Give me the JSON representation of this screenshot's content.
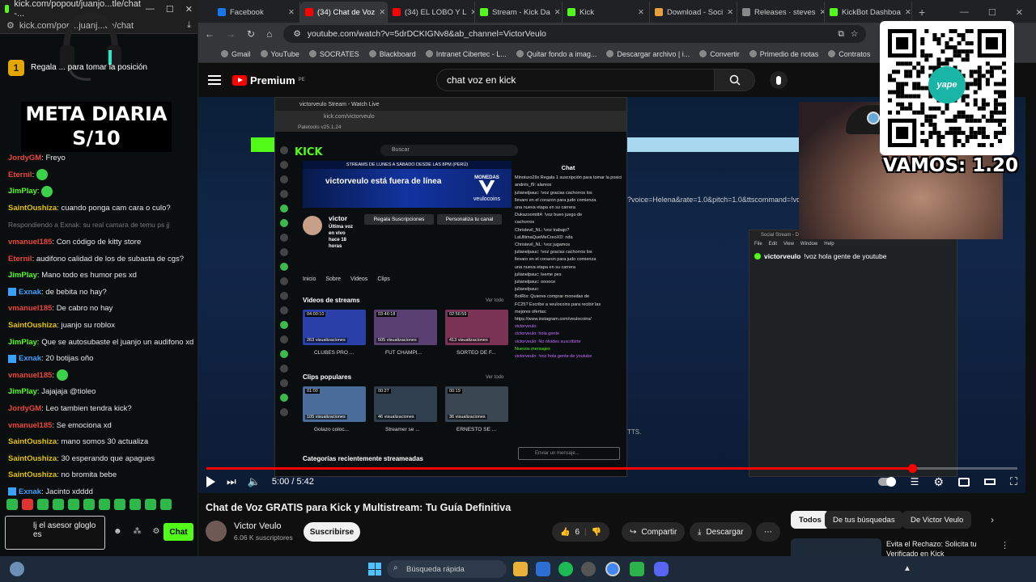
{
  "popout": {
    "title": "kick.com/popout/juanjo...tle/chat -...",
    "url": "kick.com/pop...juanj...tle/chat",
    "pinned_text": "Regala ... para tomar la posición",
    "pinned_badge": "1",
    "meta_line1": "META DIARIA",
    "meta_line2": "S/10",
    "messages": [
      {
        "user": "JordyGM",
        "text": "Freyo",
        "color": "#e9463b"
      },
      {
        "user": "Eternil",
        "text": "",
        "color": "#e9463b",
        "emote": true
      },
      {
        "user": "JimPlay",
        "text": "",
        "color": "#53fc18",
        "emote": true
      },
      {
        "user": "SaintOushiza",
        "text": "cuando ponga cam cara o culo?",
        "color": "#e3c300"
      },
      {
        "reply": "Respondiendo a Exnak: su real camara de temu ps jj"
      },
      {
        "user": "vmanuel185",
        "text": "Con código de kitty store",
        "color": "#e9463b"
      },
      {
        "user": "Eternil",
        "text": "audifono calidad de los de subasta de cgs?",
        "color": "#e9463b"
      },
      {
        "user": "JimPlay",
        "text": "Mano todo es humor pes xd",
        "color": "#53fc18"
      },
      {
        "user": "Exnak",
        "text": "de bebita no hay?",
        "color": "#3aa1ff",
        "badge": true
      },
      {
        "user": "vmanuel185",
        "text": "De cabro no hay",
        "color": "#e9463b"
      },
      {
        "user": "SaintOushiza",
        "text": "juanjo su roblox",
        "color": "#e3c300"
      },
      {
        "user": "JimPlay",
        "text": "Que se autosubaste el juanjo un audifono xd",
        "color": "#53fc18"
      },
      {
        "user": "Exnak",
        "text": "20 botijas oño",
        "color": "#3aa1ff",
        "badge": true
      },
      {
        "user": "vmanuel185",
        "text": "",
        "color": "#e9463b",
        "emote": true
      },
      {
        "user": "JimPlay",
        "text": "Jajajaja @tioleo",
        "color": "#53fc18"
      },
      {
        "user": "JordyGM",
        "text": "Leo tambien tendra kick?",
        "color": "#e9463b"
      },
      {
        "user": "vmanuel185",
        "text": "Se emociona xd",
        "color": "#e9463b"
      },
      {
        "user": "SaintOushiza",
        "text": "mano somos 30 actualiza",
        "color": "#e3c300"
      },
      {
        "user": "SaintOushiza",
        "text": "30 esperando que apagues",
        "color": "#e3c300"
      },
      {
        "user": "SaintOushiza",
        "text": "no bromita bebe",
        "color": "#e3c300"
      },
      {
        "user": "Exnak",
        "text": "Jacinto xdddd",
        "color": "#3aa1ff",
        "badge": true
      }
    ],
    "input_value": "lj el asesor gloglo es",
    "chat_button": "Chat"
  },
  "tabs": [
    {
      "label": "Facebook",
      "color": "#1877f2"
    },
    {
      "label": "(34) Chat de Voz",
      "color": "#ff0000",
      "active": true
    },
    {
      "label": "(34) EL LOBO Y L",
      "color": "#ff0000"
    },
    {
      "label": "Stream - Kick Da",
      "color": "#53fc18"
    },
    {
      "label": "Kick",
      "color": "#53fc18"
    },
    {
      "label": "Download - Soci",
      "color": "#e8a13a"
    },
    {
      "label": "Releases · steves",
      "color": "#888888"
    },
    {
      "label": "KickBot Dashboa",
      "color": "#53fc18"
    }
  ],
  "address": {
    "url": "youtube.com/watch?v=5drDCKIGNv8&ab_channel=VictorVeulo"
  },
  "bookmarks": [
    "Gmail",
    "YouTube",
    "SOCRATES",
    "Blackboard",
    "Intranet Cibertec - L...",
    "Quitar fondo a imag...",
    "Descargar archivo | i...",
    "Convertir",
    "Primedio de notas",
    "Contratos",
    "https://ciber"
  ],
  "youtube": {
    "brand": "Premium",
    "region": "PE",
    "search_value": "chat voz en kick"
  },
  "video": {
    "inner_title": "victorveulo Stream - Watch Live",
    "inner_url": "kick.com/victorveulo",
    "inner_bar": "Paletools v25.1.24",
    "kick_logo": "KICK",
    "kick_search": "Buscar",
    "banner_stripe": "STREAMS DE LUNES A SÁBADO DESDE LAS 8PM (PERÚ)",
    "banner_offline": "victorveulo está fuera de línea",
    "banner_logo": "veulocoins",
    "banner_tag": "MONEDAS",
    "profile_name": "victor",
    "profile_status": "Última voz en vivo hace 18 horas",
    "btn_subs": "Regala Suscripciones",
    "btn_custom": "Personaliza tu canal",
    "nav": [
      "Inicio",
      "Sobre",
      "Videos",
      "Clips"
    ],
    "sec_videos": "Videos de streams",
    "sec_clips": "Clips populares",
    "ver_todo": "Ver todo",
    "videos": [
      {
        "dur": "04:00:10",
        "views": "263 visualizaciones",
        "label": "CLUBES PRO ...",
        "color": "#2a3fa8"
      },
      {
        "dur": "03:46:18",
        "views": "505 visualizaciones",
        "label": "FUT CHAMPI...",
        "color": "#5a3f73"
      },
      {
        "dur": "02:56:59",
        "views": "413 visualizaciones",
        "label": "SORTEO DE F...",
        "color": "#7a3355"
      }
    ],
    "clips": [
      {
        "dur": "01:00",
        "views": "105 visualizaciones",
        "label": "Golazo coloc...",
        "color": "#4a6c9a"
      },
      {
        "dur": "00:27",
        "views": "46 visualizaciones",
        "label": "Streamer se ...",
        "color": "#2f3f4e"
      },
      {
        "dur": "00:19",
        "views": "36 visualizaciones",
        "label": "ERNESTO SE ...",
        "color": "#3a4652"
      }
    ],
    "kick_chat_header": "Chat",
    "kick_chat_lines": [
      "Minoturo29x  Regala 1 suscripción para tomar la posición 2",
      "andrés_f9: alamos",
      "julianelpauc: !voz gracias cachorros los",
      "llevaro en el corazon para judo comienza",
      "una nueva etapa en su carrera",
      "Dukazoomitt4: !voz buen juego de",
      "cachorros",
      "Christevil_NL: !voz trabajo?",
      "LaUltimaQueMeCreoXD: nda",
      "Christevil_NL: !voz jugamos",
      "julianelpauc: !voz gracias cachorros los",
      "llevaro en el corazon para judo comienza",
      "una nueva etapa en su carrera",
      "julianelpauc: leeme pes",
      "julianelpauc: ooooce",
      "julianelpauc:",
      "BotRix: Quieres comprar monedas de",
      "FC25? Escribe a veulocoins para recibir las",
      "mejores ofertas:",
      "https://www.instagram.com/veulocoins/",
      "victorveulo:",
      "victorveulo: hola gente",
      "victorveulo: No olvides suscribirte",
      "Nuevos mensajes",
      "victorveulo: !voz hola gente de youtube"
    ],
    "kick_chat_input": "Enviar un mensaje...",
    "categories": "Categorías recientemente streameadas",
    "tts_command": "?voice=Helena&rate=1.0&pitch=1.0&ttscommand=!voz",
    "tts_tail": "TTS.",
    "dash_title": "Social Stream - Dashboard",
    "dash_menu": [
      "File",
      "Edit",
      "View",
      "Window",
      "Help"
    ],
    "dash_msg_user": "victorveulo",
    "dash_msg_text": "!voz hola gente de youtube",
    "qr_brand": "yape",
    "vamos": "VAMOS: 1.20",
    "progress": 0.87,
    "time_current": "5:00",
    "time_total": "5:42"
  },
  "below": {
    "title": "Chat de Voz GRATIS para Kick y Multistream: Tu Guía Definitiva",
    "channel": "Victor Veulo",
    "subs": "6.06 K suscriptores",
    "subscribe": "Suscribirse",
    "likes": "6",
    "share": "Compartir",
    "download": "Descargar",
    "chips": [
      "Todos",
      "De tus búsquedas",
      "De Victor Veulo"
    ],
    "rec_title": "Evita el Rechazo: Solicita tu Verificado en Kick"
  },
  "taskbar": {
    "search": "Búsqueda rápida"
  }
}
